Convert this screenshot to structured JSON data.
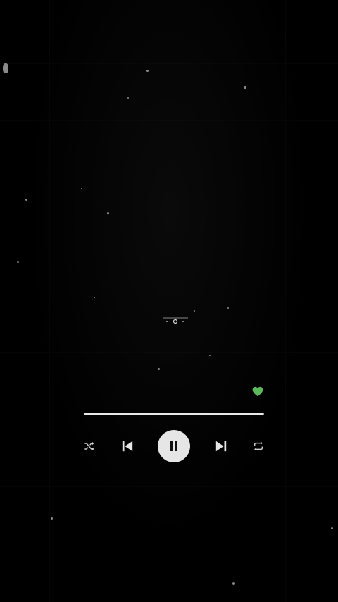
{
  "player": {
    "liked": true,
    "progress_fraction": 1.0,
    "icons": {
      "heart": "heart-icon",
      "shuffle": "shuffle-icon",
      "previous": "skip-previous-icon",
      "play_pause": "pause-icon",
      "next": "skip-next-icon",
      "repeat": "repeat-icon"
    },
    "colors": {
      "background": "#000000",
      "accent_green": "#5cb85c",
      "control": "#e6e6e6",
      "track": "#4a4a4a"
    }
  }
}
